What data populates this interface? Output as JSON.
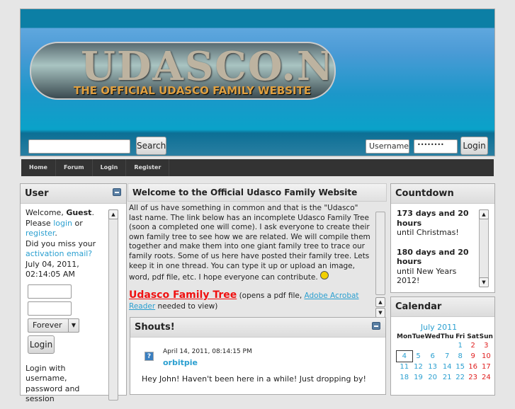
{
  "header": {
    "logo_title": "UDASCO.NET",
    "logo_subtitle": "THE OFFICIAL UDASCO FAMILY WEBSITE",
    "search_value": "",
    "search_button": "Search",
    "username_placeholder": "Username",
    "password_value": "••••••••",
    "login_button": "Login"
  },
  "nav": [
    "Home",
    "Forum",
    "Login",
    "Register"
  ],
  "user": {
    "title": "User",
    "welcome": "Welcome, ",
    "guest": "Guest",
    "please": "Please ",
    "login_link": "login",
    "or": " or",
    "register_link": "register",
    "miss": "Did you miss your",
    "activation_link": "activation email?",
    "datetime": "July 04, 2011, 02:14:05 AM",
    "duration": "Forever",
    "login_button": "Login",
    "footer": "Login with username, password and session"
  },
  "welcome": {
    "title": "Welcome to the Official Udasco Family Website",
    "body": "All of us have something in common and that is the \"Udasco\" last name. The link below has an incomplete Udasco Family Tree (soon a completed one will come). I ask everyone to create their own family tree to see how we are related. We will compile them together and make them into one giant family tree to trace our family roots. Some of us here have posted their family tree. Lets keep it in one thread. You can type it up or upload an image, word, pdf file, etc. I hope everyone can contribute.",
    "tree_link": "Udasco Family Tree",
    "tree_note": " (opens a pdf file, ",
    "acrobat_link": "Adobe Acrobat Reader",
    "tree_end": " needed to view)"
  },
  "shouts": {
    "title": "Shouts!",
    "items": [
      {
        "date": "April 14, 2011, 08:14:15 PM",
        "user": "orbitpie",
        "message": "Hey John! Haven't been here in a while! Just dropping by!"
      }
    ]
  },
  "countdown": {
    "title": "Countdown",
    "items": [
      {
        "label": "173 days and 20 hours",
        "until": "until Christmas!"
      },
      {
        "label": "180 days and 20 hours",
        "until": "until New Years 2012!"
      }
    ]
  },
  "calendar": {
    "title": "Calendar",
    "month": "July 2011",
    "days": [
      "Mon",
      "Tue",
      "Wed",
      "Thu",
      "Fri",
      "Sat",
      "Sun"
    ],
    "weeks": [
      [
        "",
        "",
        "",
        "",
        "1",
        "2",
        "3"
      ],
      [
        "4",
        "5",
        "6",
        "7",
        "8",
        "9",
        "10"
      ],
      [
        "11",
        "12",
        "13",
        "14",
        "15",
        "16",
        "17"
      ],
      [
        "18",
        "19",
        "20",
        "21",
        "22",
        "23",
        "24"
      ]
    ],
    "today": "4"
  }
}
